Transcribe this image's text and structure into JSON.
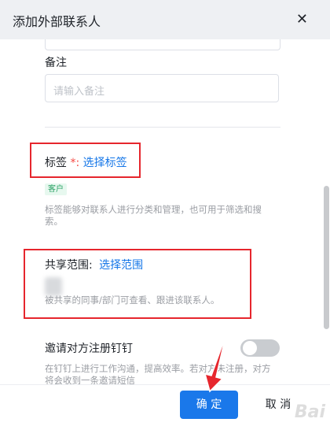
{
  "header": {
    "title": "添加外部联系人",
    "close_glyph": "✕"
  },
  "remark": {
    "label": "备注",
    "placeholder": "请输入备注"
  },
  "tags": {
    "label": "标签",
    "required_mark": "*:",
    "select_link": "选择标签",
    "selected_tag": "客户",
    "hint_line1": "标签能够对联系人进行分类和管理，也可用于筛选和搜",
    "hint_line2": "索。"
  },
  "share": {
    "label": "共享范围:",
    "select_link": "选择范围",
    "hint": "被共享的同事/部门可查看、跟进该联系人。"
  },
  "invite": {
    "label": "邀请对方注册钉钉",
    "toggle_on": false,
    "hint_line1": "在钉钉上进行工作沟通，提高效率。若对方未注册，对方",
    "hint_line2": "将会收到一条邀请短信"
  },
  "footer": {
    "confirm_label": "确 定",
    "cancel_label": "取 消"
  },
  "watermark": "Bai"
}
